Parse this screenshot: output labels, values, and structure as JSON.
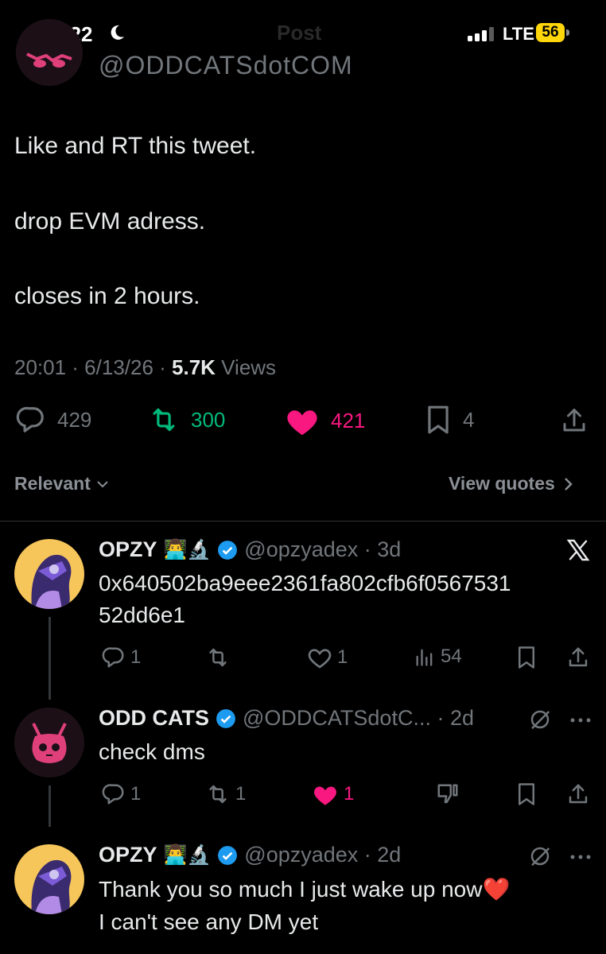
{
  "status_bar": {
    "time": "19:22",
    "network": "LTE",
    "battery": "56",
    "ghost_title": "Post"
  },
  "original_post": {
    "handle_partial": "@ODDCATSdotCOM",
    "lines": [
      "Like and RT this tweet.",
      "drop EVM adress.",
      "closes in 2 hours."
    ],
    "meta_time": "20:01 · 6/13/26 · ",
    "views_count": "5.7K",
    "views_label": " Views",
    "replies": "429",
    "reposts": "300",
    "likes": "421",
    "bookmarks": "4",
    "colors": {
      "repost": "#00ba7c",
      "like": "#f91880"
    }
  },
  "filters": {
    "sort_label": "Relevant",
    "quotes_label": "View quotes"
  },
  "replies": [
    {
      "name": "OPZY",
      "emojis": "👨‍💻🔬",
      "handle": "@opzyadex · 3d",
      "text_line1": "0x640502ba9eee2361fa802cfb6f0567531",
      "text_line2": "52dd6e1",
      "replies": "1",
      "likes": "1",
      "views": "54"
    },
    {
      "name": "ODD CATS",
      "handle": "@ODDCATSdotC... · 2d",
      "text_line1": "check dms",
      "replies": "1",
      "reposts": "1",
      "likes": "1"
    },
    {
      "name": "OPZY",
      "emojis": "👨‍💻🔬",
      "handle": "@opzyadex · 2d",
      "text_line1": "Thank you so much I just wake up now❤️",
      "text_line2": "I can't see any DM yet"
    }
  ],
  "icons": [
    "moon-icon",
    "signal-icon",
    "reply-icon",
    "repost-icon",
    "like-icon",
    "bookmark-icon",
    "share-icon",
    "chevron-down-icon",
    "chevron-right-icon",
    "verified-badge-icon",
    "x-logo-icon",
    "views-icon",
    "dislike-icon",
    "grok-icon",
    "more-icon"
  ]
}
